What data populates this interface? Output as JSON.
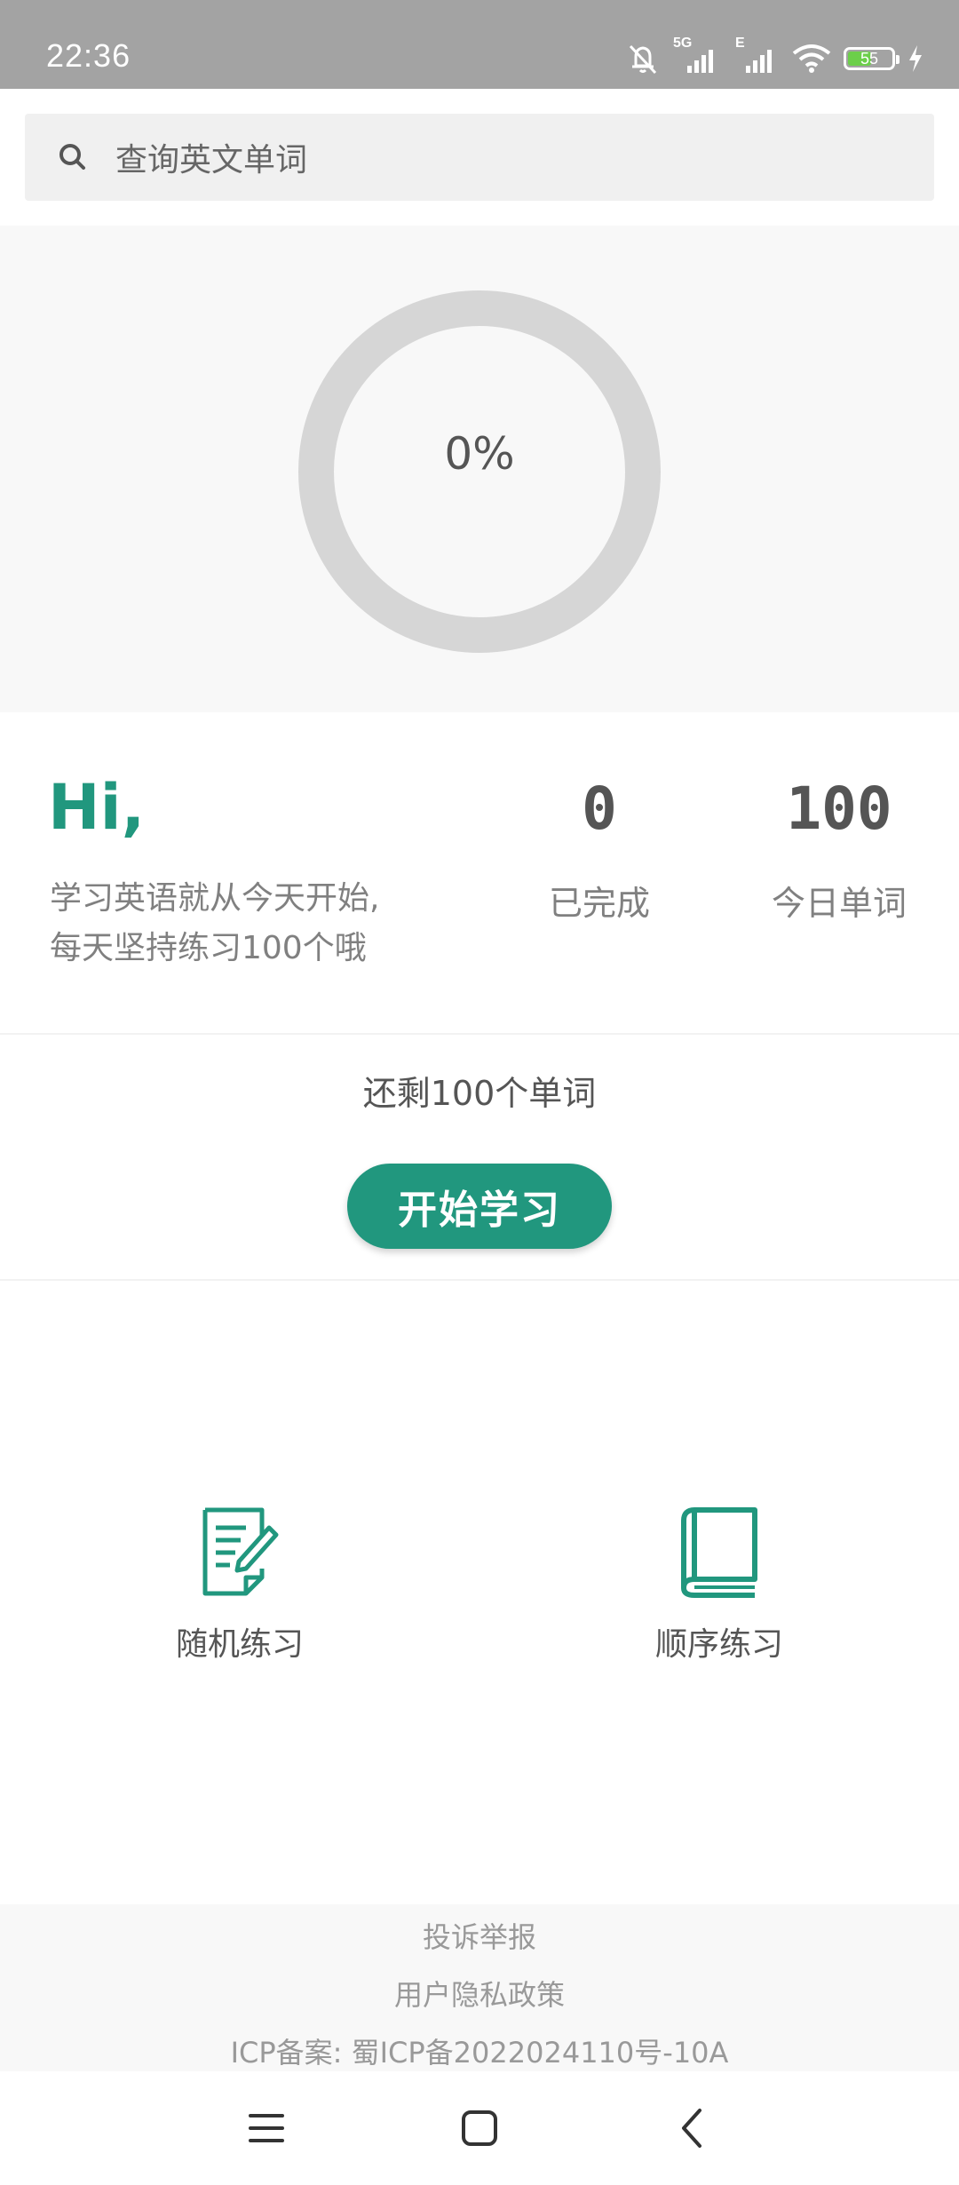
{
  "status_bar": {
    "time": "22:36",
    "network_1": "5G",
    "network_2": "E",
    "battery_level": 55,
    "battery_text": "55"
  },
  "search": {
    "placeholder": "查询英文单词"
  },
  "progress": {
    "percent_value": 0,
    "percent_text": "0%"
  },
  "greeting": {
    "title": "Hi,",
    "line1": "学习英语就从今天开始,",
    "line2": "每天坚持练习100个哦"
  },
  "stats": {
    "completed_value": "0",
    "completed_label": "已完成",
    "today_value": "100",
    "today_label": "今日单词"
  },
  "remaining_text": "还剩100个单词",
  "start_button_label": "开始学习",
  "practice": {
    "random_label": "随机练习",
    "sequential_label": "顺序练习"
  },
  "footer": {
    "report": "投诉举报",
    "privacy": "用户隐私政策",
    "icp": "ICP备案: 蜀ICP备2022024110号-10A"
  },
  "colors": {
    "accent": "#21977e",
    "status_bar": "#a3a3a3",
    "ring_track": "#d6d6d6"
  }
}
